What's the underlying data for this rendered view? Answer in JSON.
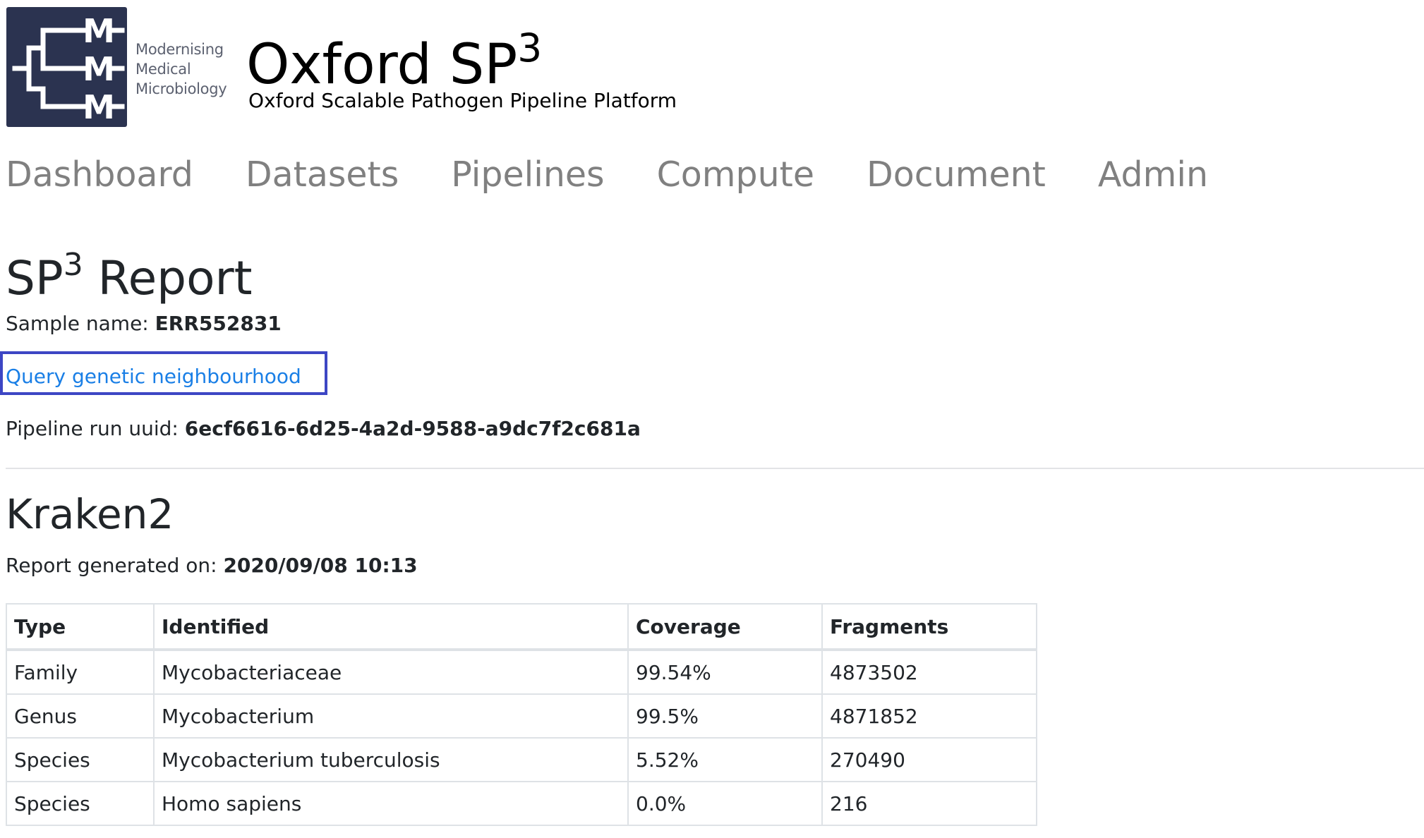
{
  "logo": {
    "lines": [
      "Modernising",
      "Medical",
      "Microbiology"
    ],
    "mark_letter": "M",
    "bg_color": "#2b3350"
  },
  "header": {
    "title_main": "Oxford SP",
    "title_sup": "3",
    "subtitle": "Oxford Scalable Pathogen Pipeline Platform"
  },
  "nav": {
    "items": [
      "Dashboard",
      "Datasets",
      "Pipelines",
      "Compute",
      "Document",
      "Admin"
    ],
    "color": "#808080"
  },
  "report": {
    "title_main": "SP",
    "title_sup": "3",
    "title_rest": " Report",
    "sample_label": "Sample name: ",
    "sample_value": "ERR552831",
    "query_link": "Query genetic neighbourhood",
    "uuid_label": "Pipeline run uuid: ",
    "uuid_value": "6ecf6616-6d25-4a2d-9588-a9dc7f2c681a",
    "link_color": "#1a7fe6",
    "highlight_color": "#3d46c4"
  },
  "kraken": {
    "title": "Kraken2",
    "generated_label": "Report generated on: ",
    "generated_value": "2020/09/08 10:13",
    "columns": [
      "Type",
      "Identified",
      "Coverage",
      "Fragments"
    ],
    "rows": [
      [
        "Family",
        "Mycobacteriaceae",
        "99.54%",
        "4873502"
      ],
      [
        "Genus",
        "Mycobacterium",
        "99.5%",
        "4871852"
      ],
      [
        "Species",
        "Mycobacterium tuberculosis",
        "5.52%",
        "270490"
      ],
      [
        "Species",
        "Homo sapiens",
        "0.0%",
        "216"
      ]
    ]
  }
}
